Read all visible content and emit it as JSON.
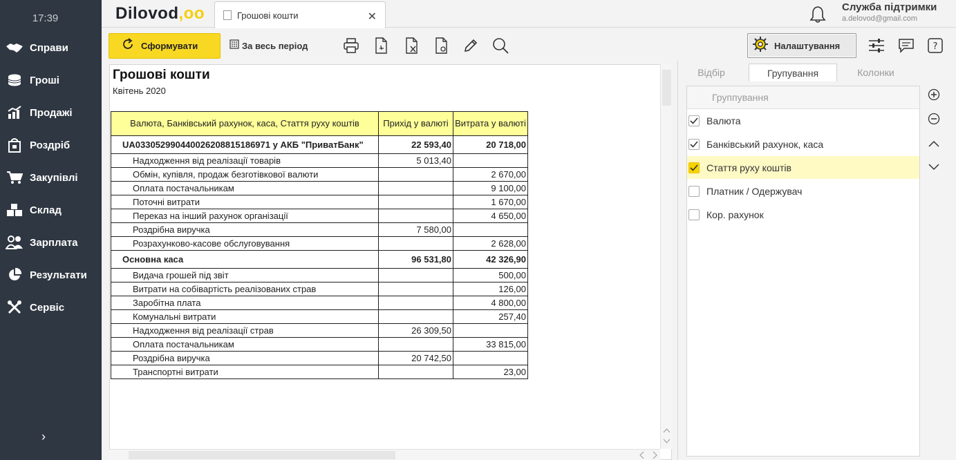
{
  "sidebar": {
    "clock": "17:39",
    "items": [
      {
        "label": "Справи",
        "icon": "handshake-icon"
      },
      {
        "label": "Гроші",
        "icon": "coins-icon"
      },
      {
        "label": "Продажі",
        "icon": "sales-chart-icon"
      },
      {
        "label": "Роздріб",
        "icon": "shopping-bag-icon"
      },
      {
        "label": "Закупівлі",
        "icon": "cart-icon"
      },
      {
        "label": "Склад",
        "icon": "warehouse-boxes-icon"
      },
      {
        "label": "Зарплата",
        "icon": "people-icon"
      },
      {
        "label": "Результати",
        "icon": "pie-chart-icon"
      },
      {
        "label": "Сервіс",
        "icon": "tools-icon"
      }
    ],
    "expand_glyph": "›"
  },
  "header": {
    "logo_text": "Dilovod",
    "logo_dots": ",oo",
    "tab_title": "Грошові кошти",
    "tab_close": "✕",
    "support_title": "Служба підтримки",
    "support_email": "a.delovod@gmail.com"
  },
  "toolbar": {
    "form_label": "Сформувати",
    "period_label": "За весь період",
    "settings_label": "Налаштування"
  },
  "report": {
    "title": "Грошові кошти",
    "subtitle": "Квітень 2020",
    "columns": [
      "Валюта, Банківський рахунок, каса, Стаття руху коштів",
      "Прихід у валюті",
      "Витрата у валюті"
    ],
    "groups": [
      {
        "name": "UA033052990440026208815186971 у АКБ \"ПриватБанк\"",
        "income": "22 593,40",
        "expense": "20 718,00",
        "rows": [
          {
            "name": "Надходження від реалізації товарів",
            "income": "5 013,40",
            "expense": ""
          },
          {
            "name": "Обмін, купівля, продаж безготівкової валюти",
            "income": "",
            "expense": "2 670,00"
          },
          {
            "name": "Оплата постачальникам",
            "income": "",
            "expense": "9 100,00"
          },
          {
            "name": "Поточні витрати",
            "income": "",
            "expense": "1 670,00"
          },
          {
            "name": "Переказ на інший рахунок організації",
            "income": "",
            "expense": "4 650,00"
          },
          {
            "name": "Роздрібна виручка",
            "income": "7 580,00",
            "expense": ""
          },
          {
            "name": "Розрахунково-касове обслуговування",
            "income": "",
            "expense": "2 628,00"
          }
        ]
      },
      {
        "name": "Основна каса",
        "income": "96 531,80",
        "expense": "42 326,90",
        "rows": [
          {
            "name": "Видача грошей під звіт",
            "income": "",
            "expense": "500,00"
          },
          {
            "name": "Витрати на собівартість реалізованих страв",
            "income": "",
            "expense": "126,00"
          },
          {
            "name": "Заробітна плата",
            "income": "",
            "expense": "4 800,00"
          },
          {
            "name": "Комунальні витрати",
            "income": "",
            "expense": "257,40"
          },
          {
            "name": "Надходження від реалізації страв",
            "income": "26 309,50",
            "expense": ""
          },
          {
            "name": "Оплата постачальникам",
            "income": "",
            "expense": "33 815,00"
          },
          {
            "name": "Роздрібна виручка",
            "income": "20 742,50",
            "expense": ""
          },
          {
            "name": "Транспортні витрати",
            "income": "",
            "expense": "23,00"
          }
        ]
      }
    ]
  },
  "panel": {
    "tabs": [
      {
        "label": "Відбір",
        "active": false
      },
      {
        "label": "Групування",
        "active": true
      },
      {
        "label": "Колонки",
        "active": false
      }
    ],
    "list_header": "Группування",
    "items": [
      {
        "label": "Валюта",
        "checked": true,
        "selected": false
      },
      {
        "label": "Банківський рахунок, каса",
        "checked": true,
        "selected": false
      },
      {
        "label": "Стаття руху коштів",
        "checked": true,
        "selected": true
      },
      {
        "label": "Платник / Одержувач",
        "checked": false,
        "selected": false
      },
      {
        "label": "Кор. рахунок",
        "checked": false,
        "selected": false
      }
    ]
  }
}
